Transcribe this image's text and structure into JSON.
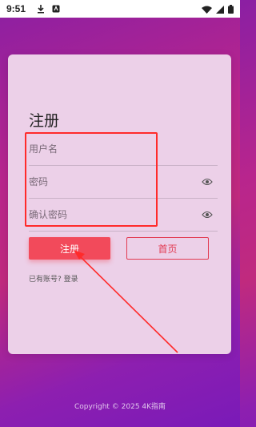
{
  "status_bar": {
    "time": "9:51",
    "icons": [
      "download-icon",
      "app-notification-icon",
      "wifi-icon",
      "signal-icon",
      "battery-icon"
    ]
  },
  "card": {
    "title": "注册",
    "username_placeholder": "用户名",
    "password_placeholder": "密码",
    "confirm_password_placeholder": "确认密码",
    "register_label": "注册",
    "home_label": "首页",
    "login_link": "已有账号? 登录"
  },
  "annotation": {
    "color": "#ff2b2b"
  },
  "footer": {
    "copyright": "Copyright © 2025 4K指南"
  },
  "colors": {
    "accent": "#f24a5b",
    "card_bg": "#ecd0e8"
  }
}
